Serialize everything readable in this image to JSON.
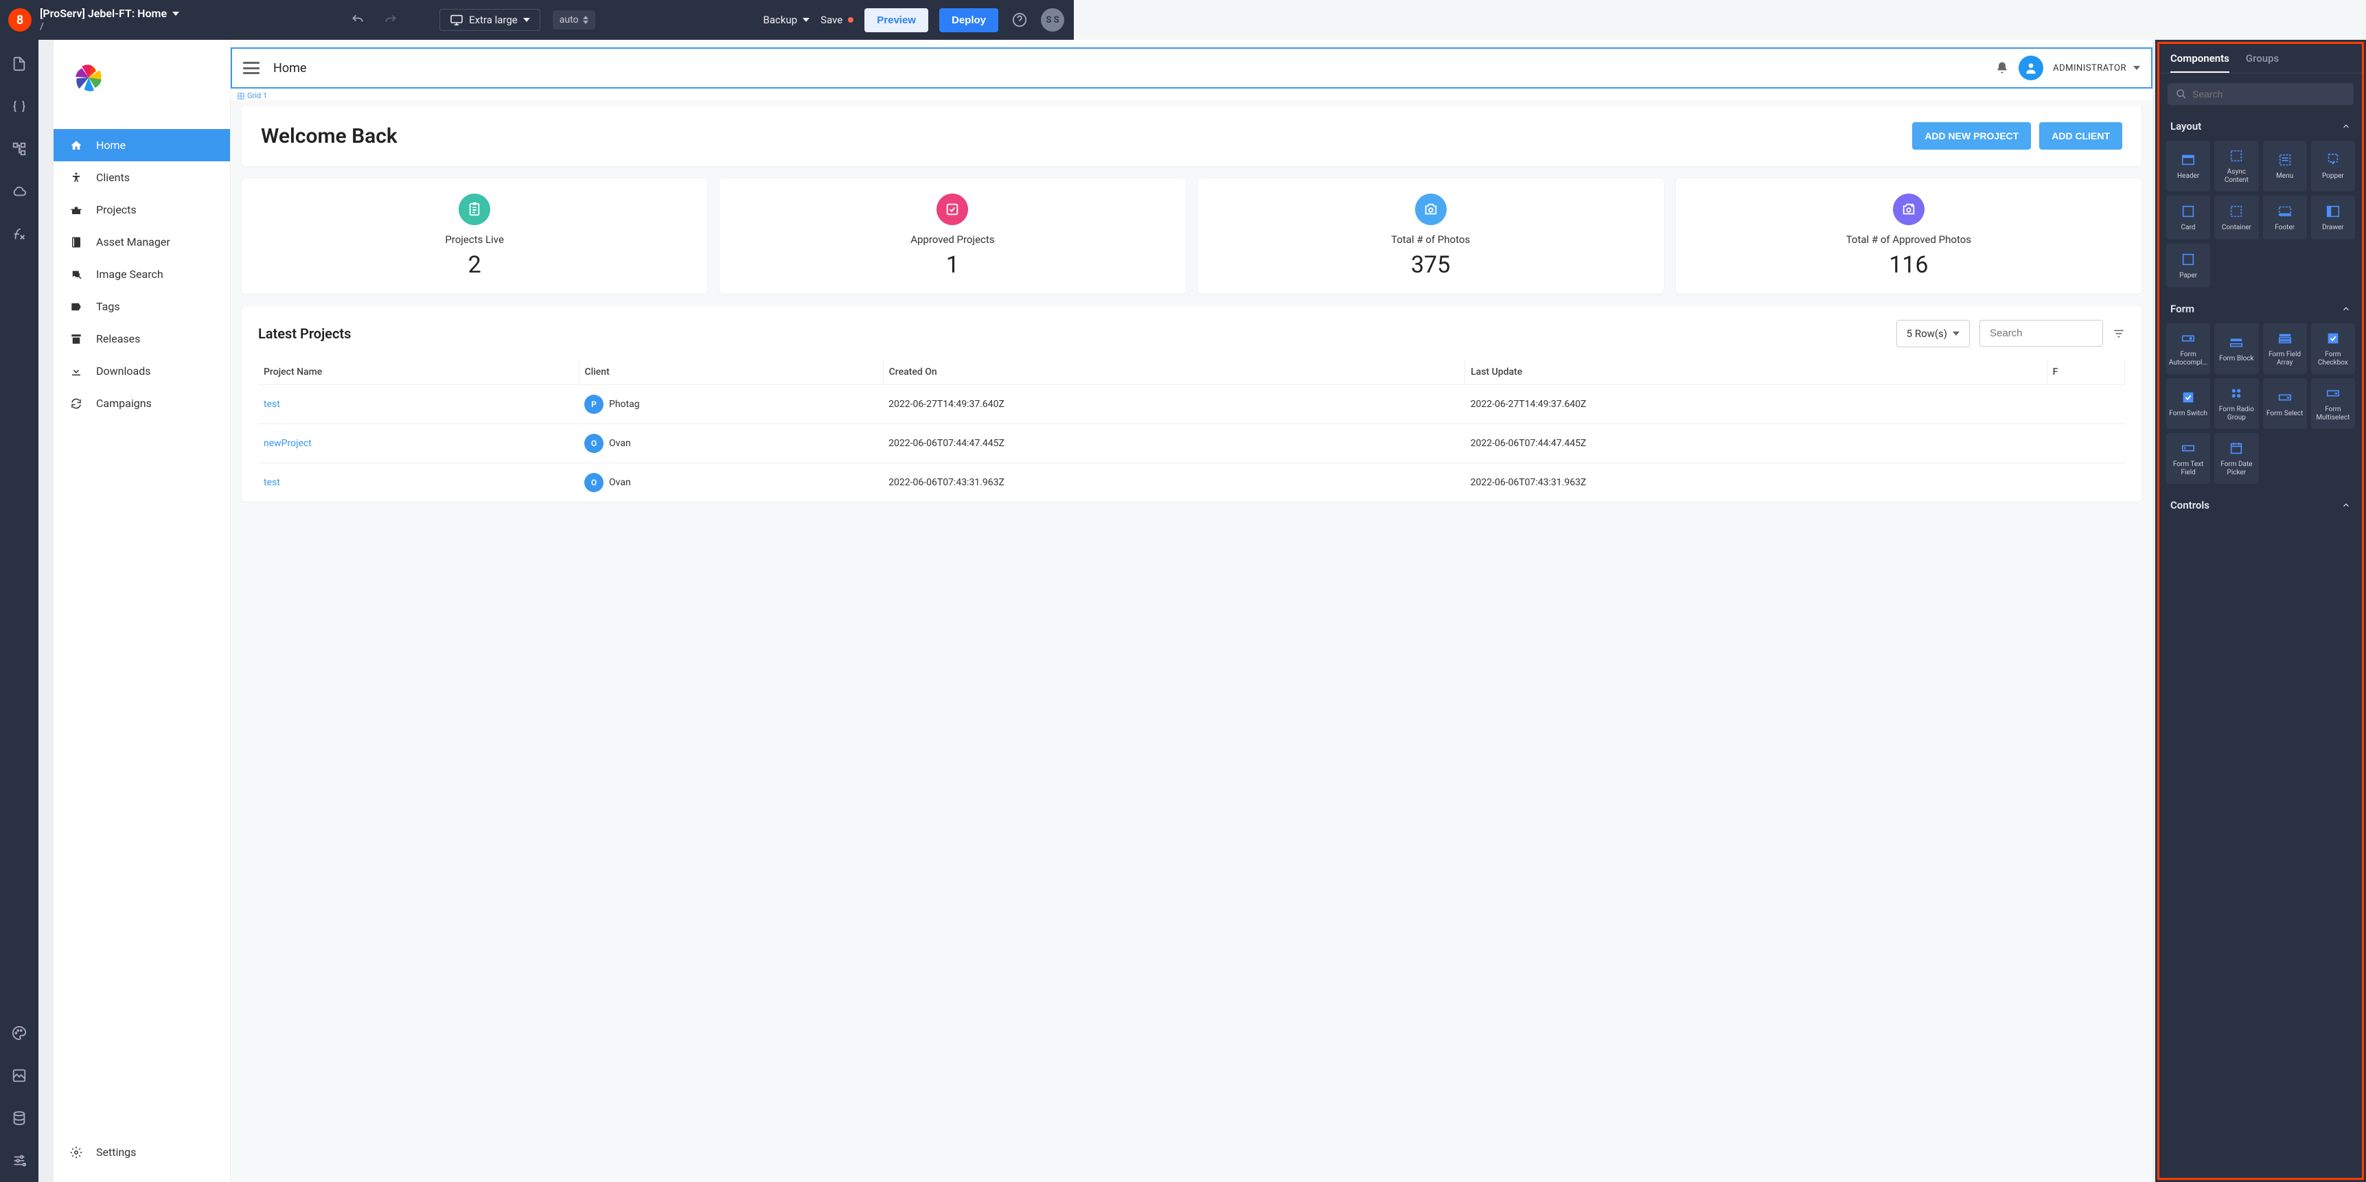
{
  "header": {
    "logo_text": "8",
    "project_title": "[ProServ] Jebel-FT: Home",
    "breadcrumb": "/",
    "viewport_label": "Extra large",
    "zoom_label": "auto",
    "backup_label": "Backup",
    "save_label": "Save",
    "preview_label": "Preview",
    "deploy_label": "Deploy",
    "avatar_initials": "S S"
  },
  "preview": {
    "appbar_title": "Home",
    "admin_label": "ADMINISTRATOR",
    "grid_tag": "Grid 1",
    "nav": [
      {
        "label": "Home",
        "icon": "home",
        "active": true
      },
      {
        "label": "Clients",
        "icon": "accessibility"
      },
      {
        "label": "Projects",
        "icon": "business"
      },
      {
        "label": "Asset Manager",
        "icon": "book"
      },
      {
        "label": "Image Search",
        "icon": "image-search"
      },
      {
        "label": "Tags",
        "icon": "label"
      },
      {
        "label": "Releases",
        "icon": "archive"
      },
      {
        "label": "Downloads",
        "icon": "download"
      },
      {
        "label": "Campaigns",
        "icon": "sync"
      }
    ],
    "settings_label": "Settings",
    "welcome_title": "Welcome Back",
    "add_project_btn": "ADD NEW PROJECT",
    "add_client_btn": "ADD CLIENT",
    "stats": [
      {
        "label": "Projects Live",
        "value": "2",
        "color": "#3dc1a8",
        "icon": "assignment"
      },
      {
        "label": "Approved Projects",
        "value": "1",
        "color": "#ec407a",
        "icon": "check"
      },
      {
        "label": "Total # of Photos",
        "value": "375",
        "color": "#4aa8f5",
        "icon": "camera"
      },
      {
        "label": "Total # of Approved Photos",
        "value": "116",
        "color": "#7b6cf6",
        "icon": "add-photo"
      }
    ],
    "latest_title": "Latest Projects",
    "rows_sel": "5 Row(s)",
    "search_placeholder": "Search",
    "columns": [
      "Project Name",
      "Client",
      "Created On",
      "Last Update",
      "F"
    ],
    "rows": [
      {
        "name": "test",
        "client": "Photag",
        "initial": "P",
        "created": "2022-06-27T14:49:37.640Z",
        "updated": "2022-06-27T14:49:37.640Z"
      },
      {
        "name": "newProject",
        "client": "Ovan",
        "initial": "O",
        "created": "2022-06-06T07:44:47.445Z",
        "updated": "2022-06-06T07:44:47.445Z"
      },
      {
        "name": "test",
        "client": "Ovan",
        "initial": "O",
        "created": "2022-06-06T07:43:31.963Z",
        "updated": "2022-06-06T07:43:31.963Z"
      }
    ]
  },
  "right": {
    "tab_components": "Components",
    "tab_groups": "Groups",
    "search_placeholder": "Search",
    "section_layout": "Layout",
    "section_form": "Form",
    "section_controls": "Controls",
    "layout_items": [
      "Header",
      "Async Content",
      "Menu",
      "Popper",
      "Card",
      "Container",
      "Footer",
      "Drawer",
      "Paper"
    ],
    "form_items": [
      "Form Autocompl...",
      "Form Block",
      "Form Field Array",
      "Form Checkbox",
      "Form Switch",
      "Form Radio Group",
      "Form Select",
      "Form Multiselect",
      "Form Text Field",
      "Form Date Picker"
    ]
  }
}
